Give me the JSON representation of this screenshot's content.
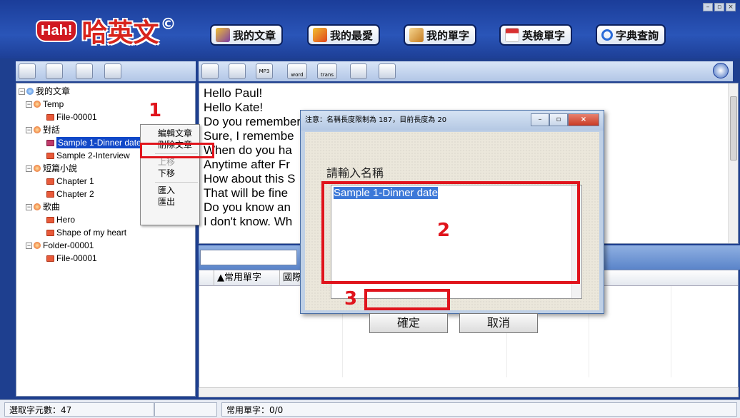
{
  "app": {
    "logo_hah": "Hah!",
    "logo_name": "哈英文",
    "logo_mark": "©"
  },
  "nav": [
    {
      "label": "我的文章",
      "icon": "abc-book-icon",
      "color": "#7c3fa8"
    },
    {
      "label": "我的最愛",
      "icon": "flag-icon",
      "color": "#e0441c"
    },
    {
      "label": "我的單字",
      "icon": "box-icon",
      "color": "#e8a33a"
    },
    {
      "label": "英檢單字",
      "icon": "calendar-icon",
      "color": "#d83030"
    },
    {
      "label": "字典查詢",
      "icon": "magnifier-icon",
      "color": "#2a6bd8"
    }
  ],
  "tree": {
    "nodes": [
      {
        "label": "我的文章",
        "kind": "root"
      },
      {
        "label": "Temp",
        "kind": "folder"
      },
      {
        "label": "File-00001",
        "kind": "file"
      },
      {
        "label": "對話",
        "kind": "folder"
      },
      {
        "label": "Sample 1-Dinner date",
        "kind": "file",
        "selected": true
      },
      {
        "label": "Sample 2-Interview",
        "kind": "file"
      },
      {
        "label": "短篇小說",
        "kind": "folder"
      },
      {
        "label": "Chapter 1",
        "kind": "file"
      },
      {
        "label": "Chapter 2",
        "kind": "file"
      },
      {
        "label": "歌曲",
        "kind": "folder"
      },
      {
        "label": "Hero",
        "kind": "file"
      },
      {
        "label": "Shape of my heart",
        "kind": "file"
      },
      {
        "label": "Folder-00001",
        "kind": "folder"
      },
      {
        "label": "File-00001",
        "kind": "file"
      }
    ]
  },
  "context_menu": {
    "items": [
      "編輯文章",
      "刪除文章",
      "上移",
      "下移",
      "匯入",
      "匯出"
    ]
  },
  "toolbar_right": {
    "word_label": "word",
    "trans_label": "trans",
    "mp3_label": "MP3"
  },
  "text_lines": [
    "Hello Paul!",
    "Hello Kate!",
    "Do you remember that you promised me to buy dinner?",
    "Sure, I remembe",
    "When do you ha",
    "Anytime after Fr",
    "How about this S",
    "That will be fine",
    "Do you know an",
    "I don't know. Wh"
  ],
  "word_table": {
    "col1": "▲常用單字",
    "col2": "國際"
  },
  "status": {
    "selected_count": "選取字元數：47",
    "common_words": "常用單字：0/0"
  },
  "dialog": {
    "title": "注意：名稱長度限制為 187，目前長度為 20",
    "prompt": "請輸入名稱",
    "value": "Sample 1-Dinner date",
    "ok_label": "確定",
    "cancel_label": "取消"
  },
  "steps": [
    "1",
    "2",
    "3"
  ]
}
